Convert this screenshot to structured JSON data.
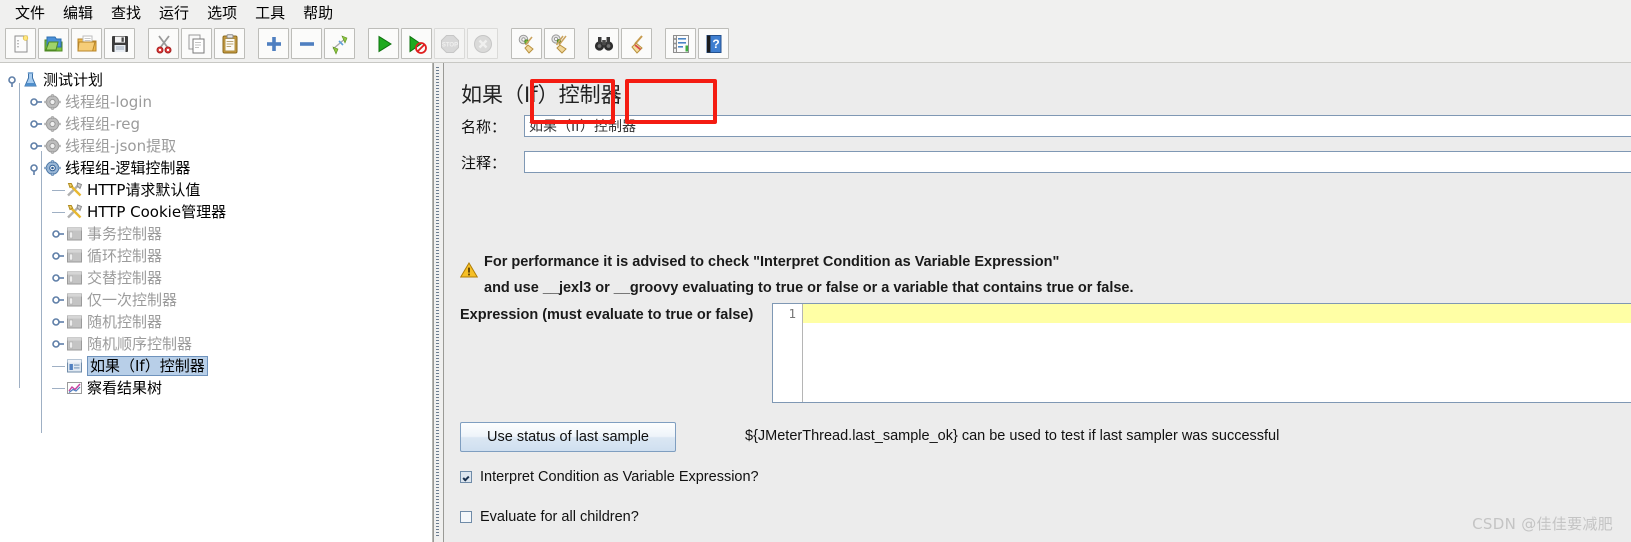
{
  "menu": {
    "items": [
      {
        "label": "文件",
        "name": "menu-file"
      },
      {
        "label": "编辑",
        "name": "menu-edit"
      },
      {
        "label": "查找",
        "name": "menu-search"
      },
      {
        "label": "运行",
        "name": "menu-run"
      },
      {
        "label": "选项",
        "name": "menu-options"
      },
      {
        "label": "工具",
        "name": "menu-tools"
      },
      {
        "label": "帮助",
        "name": "menu-help"
      }
    ]
  },
  "toolbar": {
    "buttons": [
      {
        "icon": "new-file-icon",
        "name": "new-test-plan-button",
        "disabled": false
      },
      {
        "icon": "templates-icon",
        "name": "templates-button",
        "disabled": false
      },
      {
        "icon": "open-folder-icon",
        "name": "open-button",
        "disabled": false
      },
      {
        "icon": "save-floppy-icon",
        "name": "save-button",
        "disabled": false
      },
      {
        "icon": "separator",
        "name": "toolbar-separator-1",
        "disabled": false
      },
      {
        "icon": "cut-scissors-icon",
        "name": "cut-button",
        "disabled": false
      },
      {
        "icon": "copy-icon",
        "name": "copy-button",
        "disabled": false
      },
      {
        "icon": "paste-clipboard-icon",
        "name": "paste-button",
        "disabled": false
      },
      {
        "icon": "separator",
        "name": "toolbar-separator-2",
        "disabled": false
      },
      {
        "icon": "plus-icon",
        "name": "expand-all-button",
        "disabled": false
      },
      {
        "icon": "minus-icon",
        "name": "collapse-all-button",
        "disabled": false
      },
      {
        "icon": "toggle-icon",
        "name": "toggle-button",
        "disabled": false
      },
      {
        "icon": "separator",
        "name": "toolbar-separator-3",
        "disabled": false
      },
      {
        "icon": "play-icon",
        "name": "start-button",
        "disabled": false
      },
      {
        "icon": "play-no-timers-icon",
        "name": "start-no-pauses-button",
        "disabled": false
      },
      {
        "icon": "stop-icon",
        "name": "stop-button",
        "disabled": true
      },
      {
        "icon": "shutdown-icon",
        "name": "shutdown-button",
        "disabled": true
      },
      {
        "icon": "separator",
        "name": "toolbar-separator-4",
        "disabled": false
      },
      {
        "icon": "clear-broom-icon",
        "name": "clear-button",
        "disabled": false
      },
      {
        "icon": "clear-all-broom-icon",
        "name": "clear-all-button",
        "disabled": false
      },
      {
        "icon": "separator",
        "name": "toolbar-separator-5",
        "disabled": false
      },
      {
        "icon": "binoculars-search-icon",
        "name": "search-button",
        "disabled": false
      },
      {
        "icon": "broom-reset-icon",
        "name": "reset-search-button",
        "disabled": false
      },
      {
        "icon": "separator",
        "name": "toolbar-separator-6",
        "disabled": false
      },
      {
        "icon": "function-helper-icon",
        "name": "function-helper-button",
        "disabled": false
      },
      {
        "icon": "help-book-icon",
        "name": "help-button",
        "disabled": false
      }
    ]
  },
  "tree": {
    "nodes": [
      {
        "label": "测试计划",
        "icon": "test-plan-icon",
        "depth": 0,
        "dim": false,
        "selected": false,
        "expander": "open",
        "name": "tree-node-test-plan"
      },
      {
        "label": "线程组-login",
        "icon": "thread-group-icon",
        "depth": 1,
        "dim": true,
        "selected": false,
        "expander": "closed",
        "name": "tree-node-thread-group-login"
      },
      {
        "label": "线程组-reg",
        "icon": "thread-group-icon",
        "depth": 1,
        "dim": true,
        "selected": false,
        "expander": "closed",
        "name": "tree-node-thread-group-reg"
      },
      {
        "label": "线程组-json提取",
        "icon": "thread-group-icon",
        "depth": 1,
        "dim": true,
        "selected": false,
        "expander": "closed",
        "name": "tree-node-thread-group-json"
      },
      {
        "label": "线程组-逻辑控制器",
        "icon": "thread-group-active-icon",
        "depth": 1,
        "dim": false,
        "selected": false,
        "expander": "open",
        "name": "tree-node-thread-group-logic"
      },
      {
        "label": "HTTP请求默认值",
        "icon": "config-tools-icon",
        "depth": 2,
        "dim": false,
        "selected": false,
        "expander": "leaf",
        "name": "tree-node-http-defaults"
      },
      {
        "label": "HTTP Cookie管理器",
        "icon": "config-tools-icon",
        "depth": 2,
        "dim": false,
        "selected": false,
        "expander": "leaf",
        "name": "tree-node-http-cookie-manager"
      },
      {
        "label": "事务控制器",
        "icon": "controller-icon",
        "depth": 2,
        "dim": true,
        "selected": false,
        "expander": "closed",
        "name": "tree-node-transaction-controller"
      },
      {
        "label": "循环控制器",
        "icon": "controller-icon",
        "depth": 2,
        "dim": true,
        "selected": false,
        "expander": "closed",
        "name": "tree-node-loop-controller"
      },
      {
        "label": "交替控制器",
        "icon": "controller-icon",
        "depth": 2,
        "dim": true,
        "selected": false,
        "expander": "closed",
        "name": "tree-node-interleave-controller"
      },
      {
        "label": "仅一次控制器",
        "icon": "controller-icon",
        "depth": 2,
        "dim": true,
        "selected": false,
        "expander": "closed",
        "name": "tree-node-once-only-controller"
      },
      {
        "label": "随机控制器",
        "icon": "controller-icon",
        "depth": 2,
        "dim": true,
        "selected": false,
        "expander": "closed",
        "name": "tree-node-random-controller"
      },
      {
        "label": "随机顺序控制器",
        "icon": "controller-icon",
        "depth": 2,
        "dim": true,
        "selected": false,
        "expander": "closed",
        "name": "tree-node-random-order-controller"
      },
      {
        "label": "如果（If）控制器",
        "icon": "if-controller-icon",
        "depth": 2,
        "dim": false,
        "selected": true,
        "expander": "leaf",
        "name": "tree-node-if-controller"
      },
      {
        "label": "察看结果树",
        "icon": "view-results-tree-icon",
        "depth": 2,
        "dim": false,
        "selected": false,
        "expander": "leaf",
        "name": "tree-node-view-results-tree"
      }
    ]
  },
  "panel": {
    "title": "如果（If）控制器",
    "name_label": "名称：",
    "name_value": "如果（If）控制器",
    "comment_label": "注释：",
    "comment_value": "",
    "comment_placeholder": "",
    "warning": {
      "icon": "warning-triangle-icon",
      "line1": "For performance it is advised to check \"Interpret Condition as Variable Expression\"",
      "line2_before": "and use ",
      "line2_token1": "__jexl3",
      "line2_middle": " or ",
      "line2_token2": "__groovy",
      "line2_after": " evaluating to true or false or a variable that contains true or false.",
      "highlight_color": "#f41c12"
    },
    "expression_label": "Expression (must evaluate to true or false)",
    "expression_value": "",
    "expression_line_number": "1",
    "use_last_sample_button": "Use status of last sample",
    "hint_text": "${JMeterThread.last_sample_ok} can be used to test if last sampler was successful",
    "checkboxes": [
      {
        "label": "Interpret Condition as Variable Expression?",
        "checked": true,
        "name": "interpret-condition-checkbox"
      },
      {
        "label": "Evaluate for all children?",
        "checked": false,
        "name": "evaluate-all-children-checkbox"
      }
    ]
  },
  "watermark": "CSDN @佳佳要减肥"
}
